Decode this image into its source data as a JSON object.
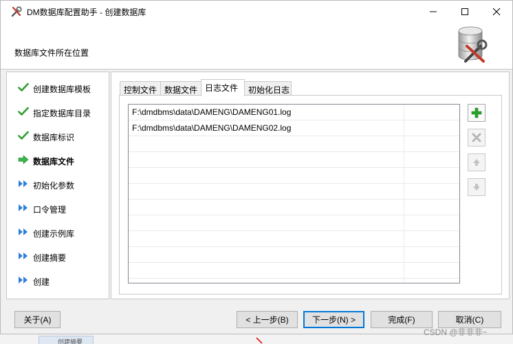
{
  "window": {
    "title": "DM数据库配置助手 - 创建数据库",
    "icons": {
      "app": "tools-icon",
      "minimize": "minimize-icon",
      "maximize": "maximize-icon",
      "close": "close-icon"
    }
  },
  "header": {
    "label": "数据库文件所在位置",
    "logo_icon": "database-tools-icon"
  },
  "sidebar": {
    "steps": [
      {
        "label": "创建数据库模板",
        "status": "done"
      },
      {
        "label": "指定数据库目录",
        "status": "done"
      },
      {
        "label": "数据库标识",
        "status": "done"
      },
      {
        "label": "数据库文件",
        "status": "current"
      },
      {
        "label": "初始化参数",
        "status": "pending"
      },
      {
        "label": "口令管理",
        "status": "pending"
      },
      {
        "label": "创建示例库",
        "status": "pending"
      },
      {
        "label": "创建摘要",
        "status": "pending"
      },
      {
        "label": "创建",
        "status": "pending"
      }
    ]
  },
  "tabs": [
    {
      "label": "控制文件",
      "active": false
    },
    {
      "label": "数据文件",
      "active": false
    },
    {
      "label": "日志文件",
      "active": true
    },
    {
      "label": "初始化日志",
      "active": false
    }
  ],
  "files": [
    "F:\\dmdbms\\data\\DAMENG\\DAMENG01.log",
    "F:\\dmdbms\\data\\DAMENG\\DAMENG02.log"
  ],
  "side_buttons": [
    {
      "icon": "add-icon",
      "enabled": true
    },
    {
      "icon": "remove-icon",
      "enabled": false
    },
    {
      "icon": "move-up-icon",
      "enabled": false
    },
    {
      "icon": "move-down-icon",
      "enabled": false
    }
  ],
  "footer": {
    "about": "关于(A)",
    "prev": "< 上一步(B)",
    "next": "下一步(N) >",
    "finish": "完成(F)",
    "cancel": "取消(C)"
  },
  "background": {
    "partial_label": "创建摘要"
  },
  "watermark": "CSDN @非非非~",
  "colors": {
    "check_green": "#2e9d2e",
    "arrow_green": "#39b54a",
    "pending_blue": "#2f7fd8",
    "focus_blue": "#0078d7",
    "add_green": "#28a428"
  }
}
